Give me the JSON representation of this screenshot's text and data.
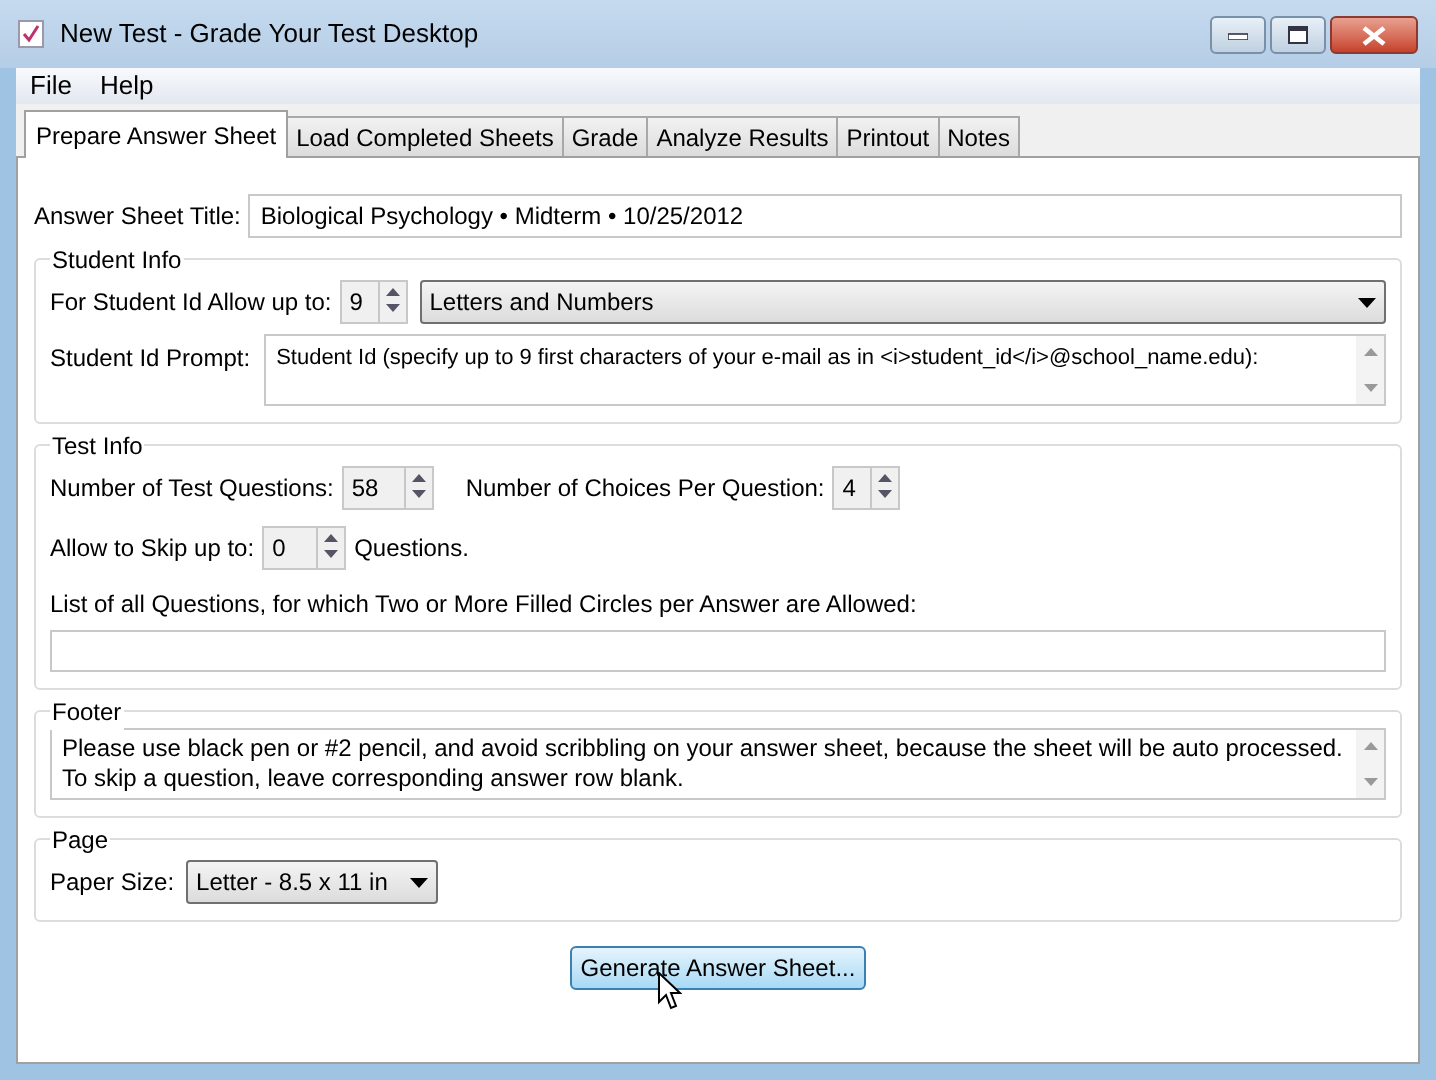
{
  "window": {
    "title": "New Test - Grade Your Test Desktop"
  },
  "menu": [
    "File",
    "Help"
  ],
  "tabs": [
    {
      "label": "Prepare Answer Sheet",
      "selected": true
    },
    {
      "label": "Load Completed Sheets",
      "selected": false
    },
    {
      "label": "Grade",
      "selected": false
    },
    {
      "label": "Analyze Results",
      "selected": false
    },
    {
      "label": "Printout",
      "selected": false
    },
    {
      "label": "Notes",
      "selected": false
    }
  ],
  "answer_sheet_title": {
    "label": "Answer Sheet Title:",
    "value": "Biological Psychology • Midterm • 10/25/2012"
  },
  "student_info": {
    "title": "Student Info",
    "id_length_label": "For Student Id Allow up to:",
    "id_length": "9",
    "id_type": "Letters and Numbers",
    "prompt_label": "Student Id Prompt:",
    "prompt": "Student Id (specify up to 9 first characters of your e-mail as in <i>student_id</i>@school_name.edu):"
  },
  "test_info": {
    "title": "Test Info",
    "questions_label": "Number of Test Questions:",
    "questions": "58",
    "choices_label": "Number of Choices Per Question:",
    "choices": "4",
    "skip_label": "Allow to Skip up to:",
    "skip": "0",
    "skip_suffix": "Questions.",
    "multi_label": "List of all Questions, for which Two or More Filled Circles per Answer are Allowed:"
  },
  "footer": {
    "title": "Footer",
    "text": "Please use black pen or #2 pencil, and avoid scribbling on your answer sheet, because the sheet will be auto processed.\nTo skip a question, leave corresponding answer row blank."
  },
  "page": {
    "title": "Page",
    "paper_label": "Paper Size:",
    "paper": "Letter - 8.5 x 11 in"
  },
  "generate_button": "Generate Answer Sheet..."
}
